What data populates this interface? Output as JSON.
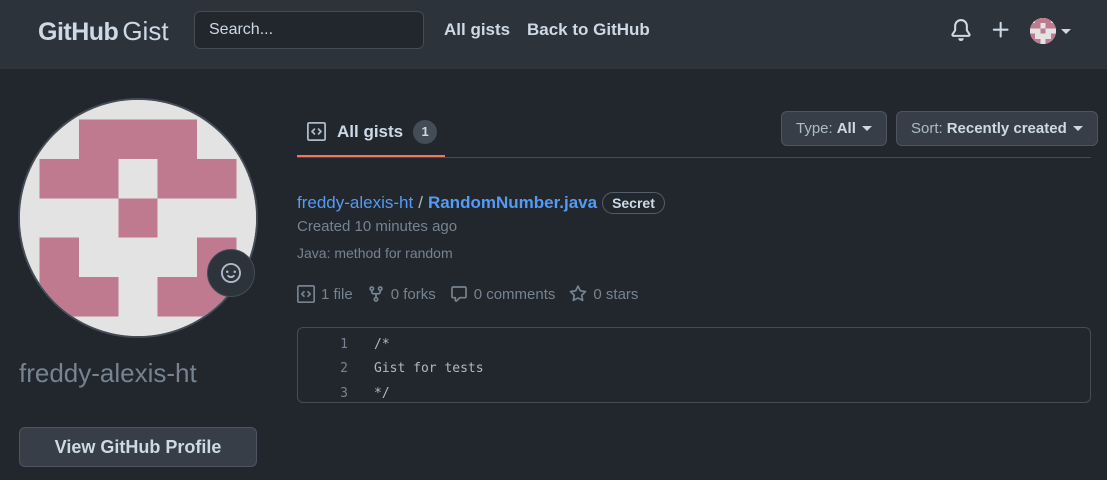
{
  "header": {
    "logo_main": "GitHub",
    "logo_sub": "Gist",
    "search_placeholder": "Search...",
    "nav": [
      "All gists",
      "Back to GitHub"
    ],
    "icons": [
      "bell-icon",
      "plus-icon",
      "avatar",
      "caret-down-icon"
    ]
  },
  "profile": {
    "username": "freddy-alexis-ht",
    "view_profile_label": "View GitHub Profile",
    "status_icon": "smiley-icon",
    "avatar_colors": {
      "bg": "#e3e3e3",
      "fg": "#c07a90"
    }
  },
  "tabs": {
    "active_label": "All gists",
    "count": "1"
  },
  "filters": {
    "type_label": "Type:",
    "type_value": "All",
    "sort_label": "Sort:",
    "sort_value": "Recently created"
  },
  "gist": {
    "owner": "freddy-alexis-ht",
    "separator": "/",
    "filename": "RandomNumber.java",
    "visibility": "Secret",
    "created": "Created 10 minutes ago",
    "description": "Java: method for random",
    "files": "1 file",
    "forks": "0 forks",
    "comments": "0 comments",
    "stars": "0 stars",
    "code_lines": [
      {
        "num": "1",
        "text": "/*"
      },
      {
        "num": "2",
        "text": "Gist for tests"
      },
      {
        "num": "3",
        "text": "*/"
      }
    ]
  },
  "colors": {
    "background": "#22272e",
    "header": "#2d333b",
    "link": "#539bf5",
    "tab_underline": "#ec775c"
  }
}
